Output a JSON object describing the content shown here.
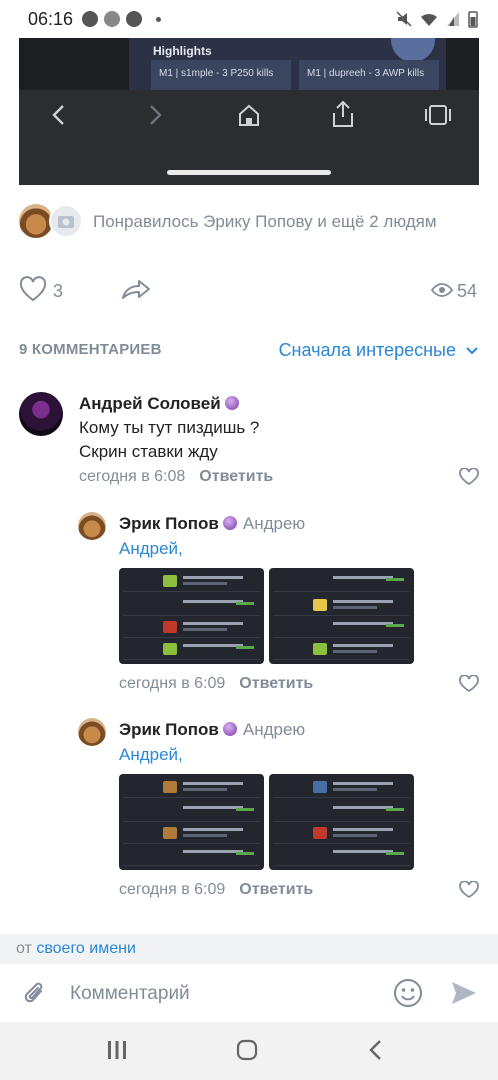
{
  "status_bar": {
    "time": "06:16"
  },
  "post_screenshot": {
    "highlights_label": "Highlights",
    "card1": "M1 | s1mple - 3 P250 kills",
    "card2": "M1 | dupreeh - 3 AWP kills"
  },
  "likes": {
    "text": "Понравилось Эрику Попову и ещё 2 людям",
    "like_count": "3",
    "view_count": "54"
  },
  "comments_header": {
    "count_label": "9 КОММЕНТАРИЕВ",
    "sort_label": "Сначала интересные"
  },
  "comments": [
    {
      "author": "Андрей Соловей",
      "line1": "Кому ты тут пиздишь ?",
      "line2": "Скрин ставки жду",
      "time": "сегодня в 6:08",
      "reply_label": "Ответить"
    },
    {
      "author": "Эрик Попов",
      "reply_to": "Андрею",
      "mention": "Андрей,",
      "time": "сегодня в 6:09",
      "reply_label": "Ответить"
    },
    {
      "author": "Эрик Попов",
      "reply_to": "Андрею",
      "mention": "Андрей,",
      "time": "сегодня в 6:09",
      "reply_label": "Ответить"
    }
  ],
  "composer": {
    "sender_prefix": "от",
    "sender_name": "своего имени",
    "placeholder": "Комментарий"
  },
  "colors": {
    "accent": "#2a86d6",
    "secondary_text": "#818c99"
  }
}
